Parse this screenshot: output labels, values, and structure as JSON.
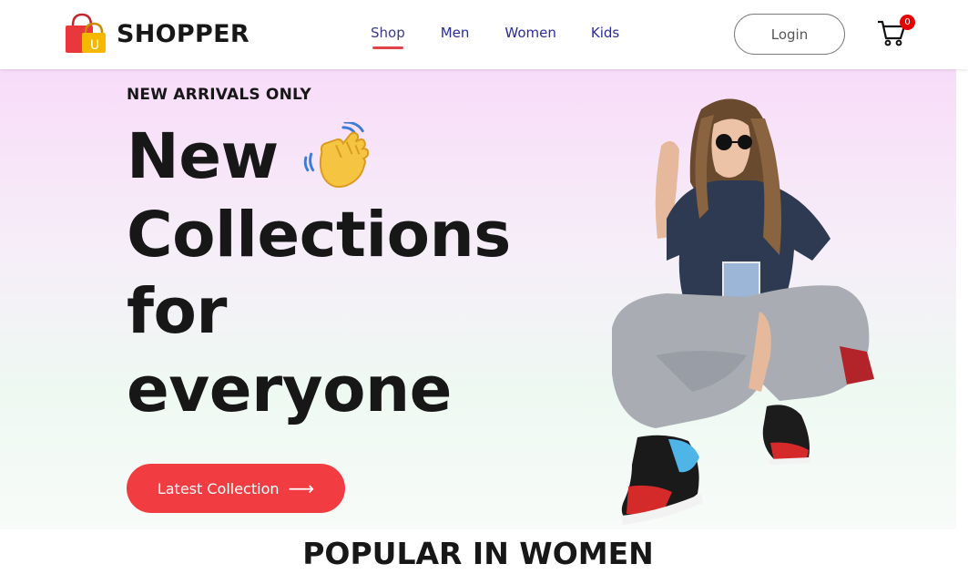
{
  "brand": {
    "name": "SHOPPER",
    "logo_letter": "U"
  },
  "nav": {
    "items": [
      {
        "label": "Shop",
        "active": true
      },
      {
        "label": "Men",
        "active": false
      },
      {
        "label": "Women",
        "active": false
      },
      {
        "label": "Kids",
        "active": false
      }
    ]
  },
  "header": {
    "login_label": "Login",
    "cart_count": "0"
  },
  "hero": {
    "tag": "NEW ARRIVALS ONLY",
    "line1": "New",
    "line2": "Collections",
    "line3": "for",
    "line4": "everyone",
    "button_label": "Latest Collection",
    "button_arrow": "⟶"
  },
  "section": {
    "title": "POPULAR IN WOMEN"
  },
  "colors": {
    "accent": "#f13d41",
    "nav_link": "#2a2aa0",
    "text_dark": "#171717",
    "hero_top": "#f8dcf9",
    "hero_bottom": "#f8fbf9"
  },
  "icons": [
    "shopping-bag-logo-icon",
    "waving-hand-icon",
    "cart-icon",
    "arrow-right-icon"
  ]
}
